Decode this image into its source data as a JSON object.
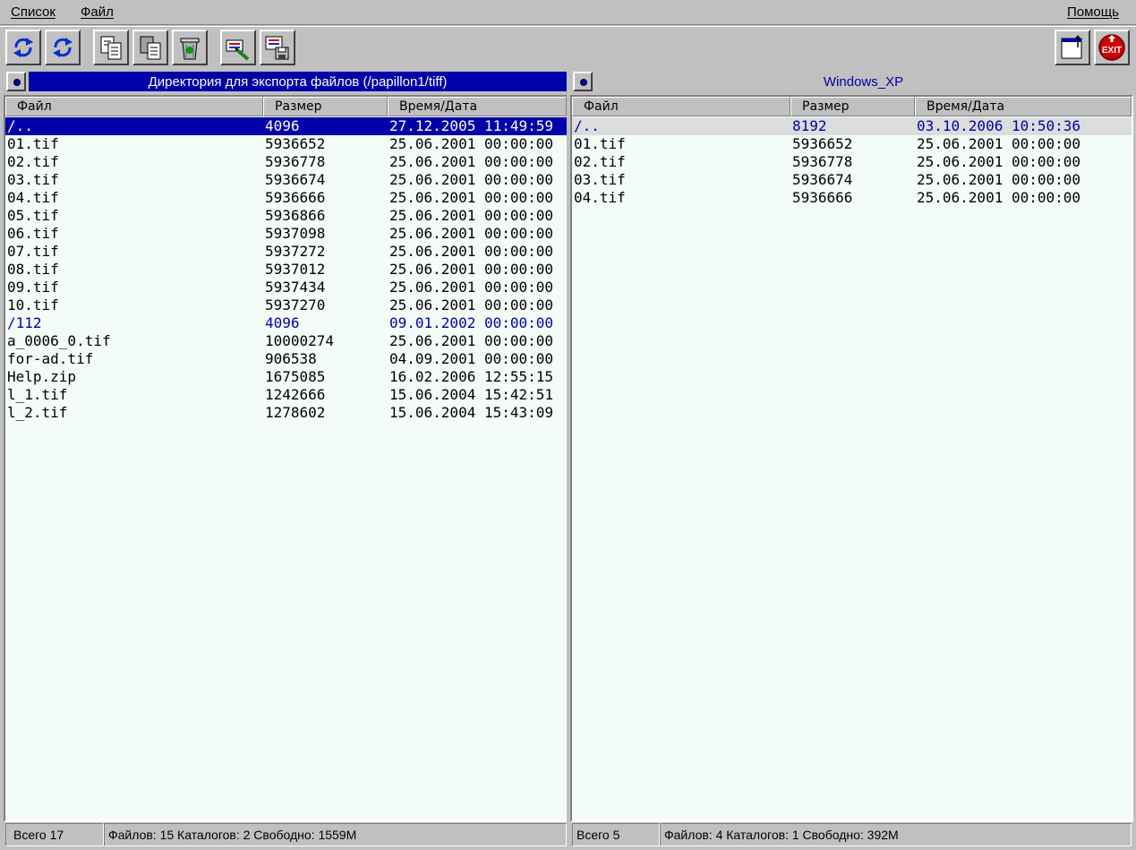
{
  "menu": {
    "list": "Список",
    "file": "Файл",
    "help": "Помощь"
  },
  "toolbar": {
    "buttons": [
      {
        "name": "refresh-left-icon"
      },
      {
        "name": "refresh-right-icon"
      },
      {
        "name": "copy-icon"
      },
      {
        "name": "move-icon"
      },
      {
        "name": "delete-icon"
      },
      {
        "name": "rename-icon"
      },
      {
        "name": "export-save-icon"
      },
      {
        "name": "window-switch-icon"
      },
      {
        "name": "exit-icon"
      }
    ],
    "exit_label": "EXIT"
  },
  "colors": {
    "accent": "#0000a8",
    "background": "#c0c0c0",
    "list_bg": "#f4fcf8",
    "exit_red": "#d00000"
  },
  "left": {
    "title": "Директория для экспорта файлов (/papillon1/tiff)",
    "columns": [
      "Файл",
      "Размер",
      "Время/Дата"
    ],
    "rows": [
      {
        "name": "/..",
        "size": "4096",
        "date": "27.12.2005 11:49:59",
        "type": "dir",
        "selected": true
      },
      {
        "name": "01.tif",
        "size": "5936652",
        "date": "25.06.2001 00:00:00",
        "type": "file"
      },
      {
        "name": "02.tif",
        "size": "5936778",
        "date": "25.06.2001 00:00:00",
        "type": "file"
      },
      {
        "name": "03.tif",
        "size": "5936674",
        "date": "25.06.2001 00:00:00",
        "type": "file"
      },
      {
        "name": "04.tif",
        "size": "5936666",
        "date": "25.06.2001 00:00:00",
        "type": "file"
      },
      {
        "name": "05.tif",
        "size": "5936866",
        "date": "25.06.2001 00:00:00",
        "type": "file"
      },
      {
        "name": "06.tif",
        "size": "5937098",
        "date": "25.06.2001 00:00:00",
        "type": "file"
      },
      {
        "name": "07.tif",
        "size": "5937272",
        "date": "25.06.2001 00:00:00",
        "type": "file"
      },
      {
        "name": "08.tif",
        "size": "5937012",
        "date": "25.06.2001 00:00:00",
        "type": "file"
      },
      {
        "name": "09.tif",
        "size": "5937434",
        "date": "25.06.2001 00:00:00",
        "type": "file"
      },
      {
        "name": "10.tif",
        "size": "5937270",
        "date": "25.06.2001 00:00:00",
        "type": "file"
      },
      {
        "name": "/112",
        "size": "4096",
        "date": "09.01.2002 00:00:00",
        "type": "dir"
      },
      {
        "name": "a_0006_0.tif",
        "size": "10000274",
        "date": "25.06.2001 00:00:00",
        "type": "file"
      },
      {
        "name": "for-ad.tif",
        "size": "906538",
        "date": "04.09.2001 00:00:00",
        "type": "file"
      },
      {
        "name": "Help.zip",
        "size": "1675085",
        "date": "16.02.2006 12:55:15",
        "type": "file"
      },
      {
        "name": "l_1.tif",
        "size": "1242666",
        "date": "15.06.2004 15:42:51",
        "type": "file"
      },
      {
        "name": "l_2.tif",
        "size": "1278602",
        "date": "15.06.2004 15:43:09",
        "type": "file"
      }
    ],
    "status_total": "Всего 17",
    "status_info": "Файлов: 15 Каталогов: 2 Свободно: 1559M"
  },
  "right": {
    "title": "Windows_XP",
    "columns": [
      "Файл",
      "Размер",
      "Время/Дата"
    ],
    "rows": [
      {
        "name": "/..",
        "size": "8192",
        "date": "03.10.2006 10:50:36",
        "type": "dir",
        "cursor": true
      },
      {
        "name": "01.tif",
        "size": "5936652",
        "date": "25.06.2001 00:00:00",
        "type": "file"
      },
      {
        "name": "02.tif",
        "size": "5936778",
        "date": "25.06.2001 00:00:00",
        "type": "file"
      },
      {
        "name": "03.tif",
        "size": "5936674",
        "date": "25.06.2001 00:00:00",
        "type": "file"
      },
      {
        "name": "04.tif",
        "size": "5936666",
        "date": "25.06.2001 00:00:00",
        "type": "file"
      }
    ],
    "status_total": "Всего 5",
    "status_info": "Файлов: 4 Каталогов: 1 Свободно: 392M"
  }
}
